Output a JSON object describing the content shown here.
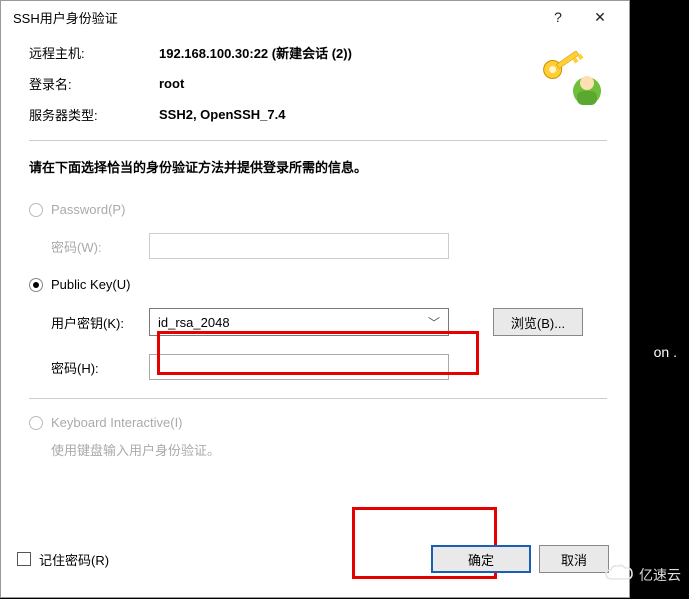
{
  "titlebar": {
    "title": "SSH用户身份验证",
    "help": "?",
    "close": "✕"
  },
  "info": {
    "host_label": "远程主机:",
    "host_value": "192.168.100.30:22 (新建会话 (2))",
    "login_label": "登录名:",
    "login_value": "root",
    "server_label": "服务器类型:",
    "server_value": "SSH2, OpenSSH_7.4"
  },
  "instruction": "请在下面选择恰当的身份验证方法并提供登录所需的信息。",
  "password_section": {
    "radio_label": "Password(P)",
    "pw_label": "密码(W):"
  },
  "publickey_section": {
    "radio_label": "Public Key(U)",
    "key_label": "用户密钥(K):",
    "key_value": "id_rsa_2048",
    "browse_label": "浏览(B)...",
    "pw_label": "密码(H):"
  },
  "keyboard_section": {
    "radio_label": "Keyboard Interactive(I)",
    "hint": "使用键盘输入用户身份验证。"
  },
  "bottom": {
    "remember_label": "记住密码(R)",
    "ok": "确定",
    "cancel": "取消"
  },
  "behind_text": "on .",
  "watermark": "亿速云"
}
